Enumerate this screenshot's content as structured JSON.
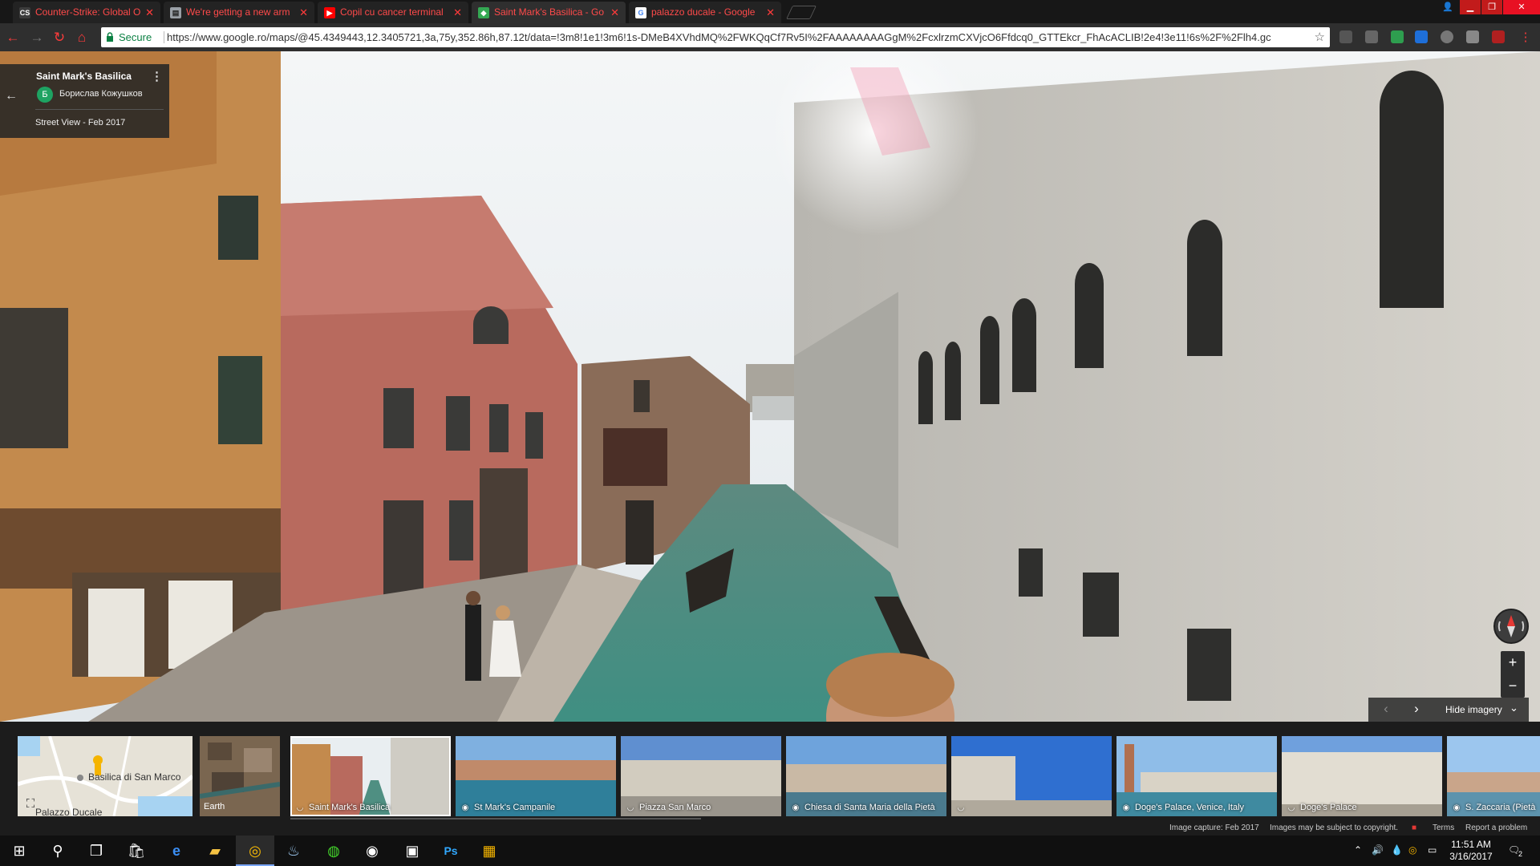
{
  "browser": {
    "tabs": [
      {
        "title": "Counter-Strike: Global O",
        "icon": "cs-icon",
        "color": "#3c3c3c",
        "icon_text": "CS"
      },
      {
        "title": "We're getting a new arm",
        "icon": "page-icon",
        "color": "#9aa0a6",
        "icon_text": "▤"
      },
      {
        "title": "Copil cu cancer terminal",
        "icon": "youtube-icon",
        "color": "#ff0000",
        "icon_text": "▶"
      },
      {
        "title": "Saint Mark's Basilica - Go",
        "icon": "google-maps-icon",
        "color": "#34a853",
        "icon_text": "◆"
      },
      {
        "title": "palazzo ducale - Google",
        "icon": "google-icon",
        "color": "#4285f4",
        "icon_text": "G"
      }
    ],
    "active_tab": 3,
    "secure_label": "Secure",
    "url": "https://www.google.ro/maps/@45.4349443,12.3405721,3a,75y,352.86h,87.12t/data=!3m8!1e1!3m6!1s-DMeB4XVhdMQ%2FWKQqCf7Rv5I%2FAAAAAAAAGgM%2FcxlrzmCXVjcO6Ffdcq0_GTTEkcr_FhAcACLIB!2e4!3e11!6s%2F%2Flh4.gc",
    "accent": "#ff3b3b"
  },
  "streetview": {
    "place_title": "Saint Mark's Basilica",
    "author_initial": "Б",
    "author_name": "Борислав Кожушков",
    "capture_label": "Street View - Feb 2017",
    "hide_imagery": "Hide imagery",
    "zoom_in": "+",
    "zoom_out": "−"
  },
  "minimap": {
    "label": "Basilica di San Marco",
    "label2": "Palazzo Ducale"
  },
  "earth_label": "Earth",
  "thumbnails": [
    {
      "label": "Saint Mark's Basilica",
      "icon": "panorama-icon",
      "selected": true
    },
    {
      "label": "St Mark's Campanile",
      "icon": "camera-icon",
      "selected": false
    },
    {
      "label": "Piazza San Marco",
      "icon": "panorama-icon",
      "selected": false
    },
    {
      "label": "Chiesa di Santa Maria della Pietà",
      "icon": "camera-icon",
      "selected": false
    },
    {
      "label": "",
      "icon": "panorama-icon",
      "selected": false
    },
    {
      "label": "Doge's Palace, Venice, Italy",
      "icon": "camera-icon",
      "selected": false
    },
    {
      "label": "Doge's Palace",
      "icon": "panorama-icon",
      "selected": false
    },
    {
      "label": "S. Zaccaria (Pietà",
      "icon": "camera-icon",
      "selected": false
    }
  ],
  "footer": {
    "capture": "Image capture: Feb 2017",
    "copyright": "Images may be subject to copyright.",
    "terms": "Terms",
    "report": "Report a problem"
  },
  "taskbar": {
    "time": "11:51 AM",
    "date": "3/16/2017",
    "notifications": "2"
  }
}
